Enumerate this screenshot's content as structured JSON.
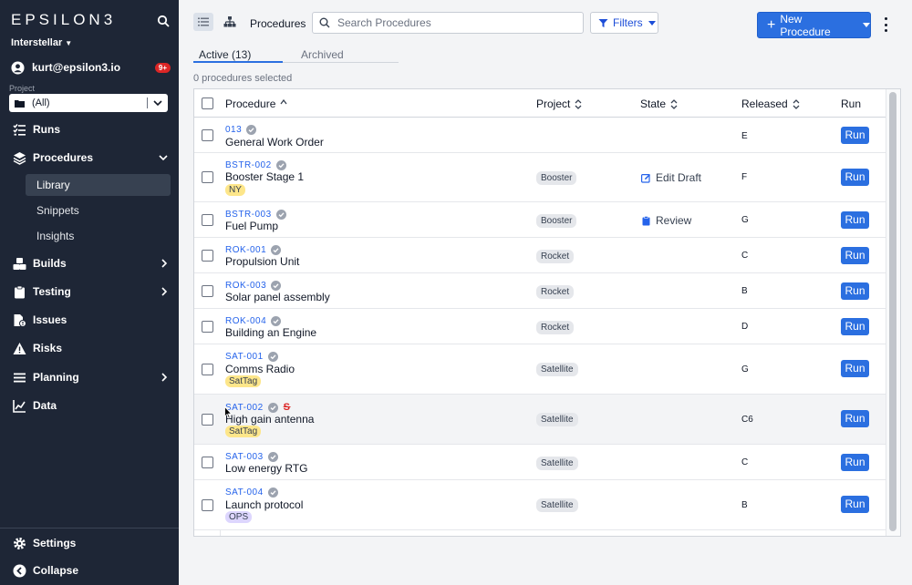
{
  "sidebar": {
    "logo": "EPSILON3",
    "workspace": "Interstellar",
    "user": {
      "email": "kurt@epsilon3.io",
      "notifications": "9+"
    },
    "project_label": "Project",
    "project_value": "(All)",
    "nav": [
      {
        "label": "Runs",
        "icon": "run-list-icon"
      },
      {
        "label": "Procedures",
        "icon": "layers-icon",
        "expanded": true
      },
      {
        "label": "Builds",
        "icon": "cubes-icon"
      },
      {
        "label": "Testing",
        "icon": "clipboard-icon"
      },
      {
        "label": "Issues",
        "icon": "file-alert-icon"
      },
      {
        "label": "Risks",
        "icon": "warning-icon"
      },
      {
        "label": "Planning",
        "icon": "bars-icon"
      },
      {
        "label": "Data",
        "icon": "chart-line-icon"
      }
    ],
    "sub_nav": [
      "Library",
      "Snippets",
      "Insights"
    ],
    "settings": "Settings",
    "collapse": "Collapse"
  },
  "header": {
    "breadcrumb": "Procedures",
    "search_placeholder": "Search Procedures",
    "filters_label": "Filters",
    "new_label": "New Procedure"
  },
  "tabs": {
    "active": "Active (13)",
    "archived": "Archived"
  },
  "selected_count": "0 procedures selected",
  "table": {
    "columns": {
      "procedure": "Procedure",
      "project": "Project",
      "state": "State",
      "released": "Released",
      "run": "Run"
    },
    "rows": [
      {
        "code": "013",
        "name": "General Work Order",
        "tag": "",
        "project": "",
        "state": "",
        "released": "E"
      },
      {
        "code": "BSTR-002",
        "name": "Booster Stage 1",
        "tag": "NY",
        "project": "Booster",
        "state": "Edit Draft",
        "released": "F"
      },
      {
        "code": "BSTR-003",
        "name": "Fuel Pump",
        "tag": "",
        "project": "Booster",
        "state": "Review",
        "released": "G"
      },
      {
        "code": "ROK-001",
        "name": "Propulsion Unit",
        "tag": "",
        "project": "Rocket",
        "state": "",
        "released": "C"
      },
      {
        "code": "ROK-003",
        "name": "Solar panel assembly",
        "tag": "",
        "project": "Rocket",
        "state": "",
        "released": "B"
      },
      {
        "code": "ROK-004",
        "name": "Building an Engine",
        "tag": "",
        "project": "Rocket",
        "state": "",
        "released": "D"
      },
      {
        "code": "SAT-001",
        "name": "Comms Radio",
        "tag": "SatTag",
        "project": "Satellite",
        "state": "",
        "released": "G"
      },
      {
        "code": "SAT-002",
        "name": "High gain antenna",
        "tag": "SatTag",
        "project": "Satellite",
        "state": "",
        "released": "C6",
        "strike": "S"
      },
      {
        "code": "SAT-003",
        "name": "Low energy RTG",
        "tag": "",
        "project": "Satellite",
        "state": "",
        "released": "C"
      },
      {
        "code": "SAT-004",
        "name": "Launch protocol",
        "tag": "OPS",
        "project": "Satellite",
        "state": "",
        "released": "B"
      }
    ],
    "run_label": "Run"
  },
  "colors": {
    "sidebar": "#1e2636",
    "accent": "#2b6fe0",
    "link": "#2563eb"
  }
}
